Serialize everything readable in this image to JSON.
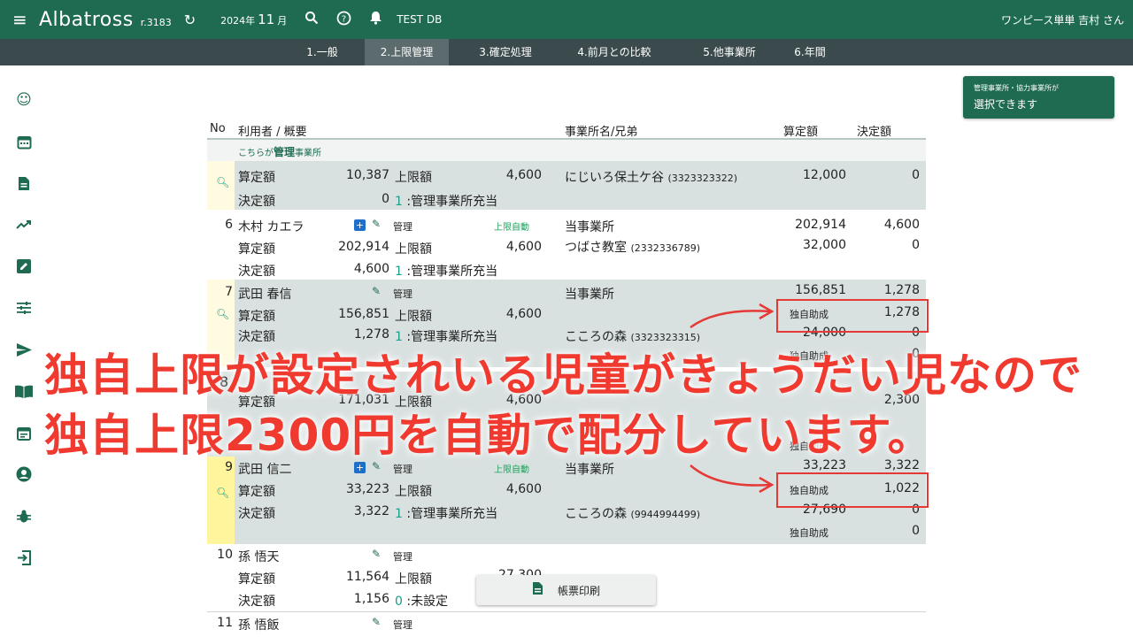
{
  "topbar": {
    "app_name": "Albatross",
    "version": "r.3183",
    "year_label": "2024年",
    "month": "11",
    "month_suffix": "月",
    "db_name": "TEST DB",
    "user": "ワンピース単単 吉村 さん"
  },
  "tabs": [
    {
      "label": "1.一般"
    },
    {
      "label": "2.上限管理"
    },
    {
      "label": "3.確定処理"
    },
    {
      "label": "4.前月との比較"
    },
    {
      "label": "5.他事業所"
    },
    {
      "label": "6.年間"
    }
  ],
  "select_button": {
    "line1": "管理事業所・協力事業所が",
    "line2": "選択できます"
  },
  "headers": {
    "no": "No",
    "user": "利用者 / 概要",
    "office": "事業所名/兄弟",
    "santei": "算定額",
    "kettei": "決定額"
  },
  "note": {
    "prefix": "こちらが",
    "bold": "管理",
    "suffix": "事業所"
  },
  "labels": {
    "santei": "算定額",
    "kettei": "決定額",
    "jougen": "上限額",
    "kanri": "管理",
    "auto": "上限自動",
    "touzigyousho": "当事業所",
    "dokuji": "独自助成"
  },
  "rows": {
    "r0": {
      "santei": "10,387",
      "jougen": "4,600",
      "kettei": "0",
      "kbn_num": "1",
      "kbn_text": ":管理事業所充当",
      "office": "にじいろ保土ケ谷",
      "office_code": "(3323323322)",
      "o_santei": "12,000",
      "o_kettei": "0"
    },
    "r6": {
      "no": "6",
      "name": "木村 カエラ",
      "santei": "202,914",
      "jougen": "4,600",
      "kettei": "4,600",
      "kbn_num": "1",
      "kbn_text": ":管理事業所充当",
      "own_santei": "202,914",
      "own_kettei": "4,600",
      "office": "つばさ教室",
      "office_code": "(2332336789)",
      "o_santei": "32,000",
      "o_kettei": "0"
    },
    "r7": {
      "no": "7",
      "name": "武田 春信",
      "santei": "156,851",
      "jougen": "4,600",
      "kettei": "1,278",
      "kbn_num": "1",
      "kbn_text": ":管理事業所充当",
      "own_santei": "156,851",
      "own_kettei": "1,278",
      "dokuji_val": "1,278",
      "office": "こころの森",
      "office_code": "(3323323315)",
      "o_santei": "24,000",
      "o_kettei": "0",
      "o_dokuji": "0"
    },
    "r8": {
      "no": "8",
      "santei": "171,031",
      "jougen": "4,600",
      "val2": "2,300"
    },
    "r9": {
      "no": "9",
      "name": "武田 信二",
      "santei": "33,223",
      "jougen": "4,600",
      "kettei": "3,322",
      "kbn_num": "1",
      "kbn_text": ":管理事業所充当",
      "own_santei": "33,223",
      "own_kettei": "3,322",
      "dokuji_val": "1,022",
      "office": "こころの森",
      "office_code": "(9944994499)",
      "o_santei": "27,690",
      "o_kettei": "0",
      "o_dokuji": "0"
    },
    "r10": {
      "no": "10",
      "name": "孫 悟天",
      "santei": "11,564",
      "jougen": "27,300",
      "kettei": "1,156",
      "kbn_num": "0",
      "kbn_text": ":未設定"
    },
    "r11": {
      "no": "11",
      "name": "孫 悟飯"
    }
  },
  "overlay": {
    "line1": "独自上限が設定されいる児童がきょうだい児なので",
    "line2": "独自上限2300円を自動で配分しています。"
  },
  "print_button": {
    "label": "帳票印刷"
  }
}
